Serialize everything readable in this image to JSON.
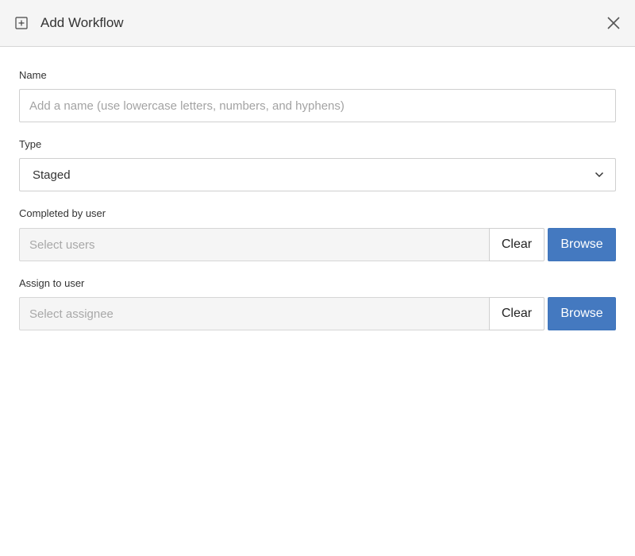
{
  "dialog": {
    "title": "Add Workflow",
    "title_icon": "plus-square-icon",
    "close_icon": "close-icon"
  },
  "form": {
    "name": {
      "label": "Name",
      "value": "",
      "placeholder": "Add a name (use lowercase letters, numbers, and hyphens)"
    },
    "type": {
      "label": "Type",
      "selected": "Staged",
      "icon": "chevron-down-icon"
    },
    "completed_by_user": {
      "label": "Completed by user",
      "value": "",
      "placeholder": "Select users",
      "clear_label": "Clear",
      "browse_label": "Browse"
    },
    "assign_to_user": {
      "label": "Assign to user",
      "value": "",
      "placeholder": "Select assignee",
      "clear_label": "Clear",
      "browse_label": "Browse"
    }
  },
  "colors": {
    "header_bg": "#f5f5f5",
    "primary": "#4479c0",
    "readonly_input_bg": "#f5f5f5",
    "border": "#cfcfcf"
  }
}
